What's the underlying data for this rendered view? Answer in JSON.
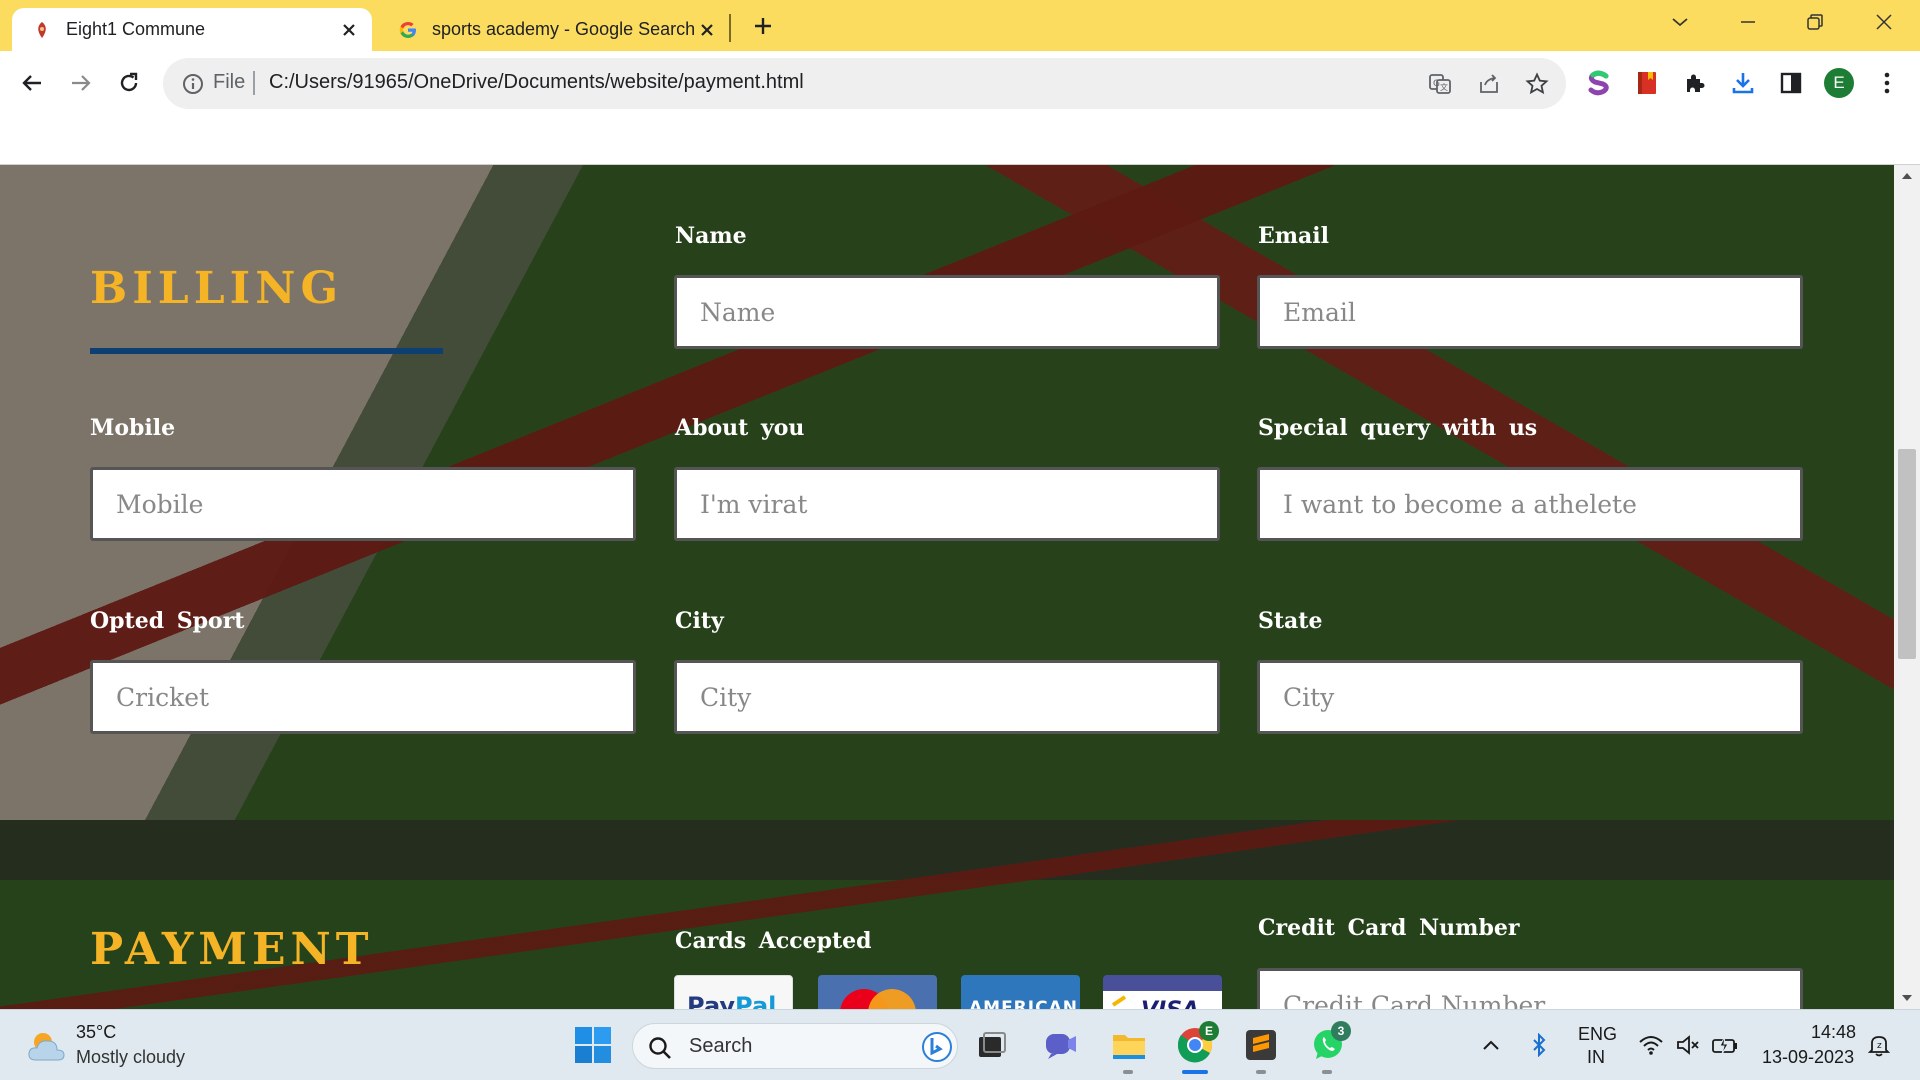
{
  "browser": {
    "tabs": [
      {
        "title": "Eight1 Commune",
        "active": true,
        "favicon": "app-favicon"
      },
      {
        "title": "sports academy - Google Search",
        "active": false,
        "favicon": "google-favicon"
      }
    ],
    "address": {
      "scheme_label": "File",
      "url": "C:/Users/91965/OneDrive/Documents/website/payment.html"
    },
    "profile_initial": "E"
  },
  "page": {
    "billing": {
      "title": "BILLING",
      "fields": [
        {
          "label": "Name",
          "placeholder": "Name"
        },
        {
          "label": "Email",
          "placeholder": "Email"
        },
        {
          "label": "Mobile",
          "placeholder": "Mobile"
        },
        {
          "label": "About  you",
          "placeholder": "I'm virat"
        },
        {
          "label": "Special  query  with  us",
          "placeholder": "I want to become a athelete"
        },
        {
          "label": "Opted  Sport",
          "placeholder": "Cricket"
        },
        {
          "label": "City",
          "placeholder": "City"
        },
        {
          "label": "State",
          "placeholder": "City"
        }
      ]
    },
    "payment": {
      "title": "PAYMENT",
      "cards_label": "Cards  Accepted",
      "card_number_label": "Credit  Card  Number",
      "card_number_placeholder": "Credit Card Number",
      "cards": [
        "PayPal",
        "Mastercard",
        "American Express",
        "Visa"
      ]
    }
  },
  "taskbar": {
    "weather": {
      "temp": "35°C",
      "desc": "Mostly cloudy"
    },
    "search_placeholder": "Search",
    "chrome_badge": "E",
    "whatsapp_badge": "3",
    "lang": {
      "line1": "ENG",
      "line2": "IN"
    },
    "clock": {
      "time": "14:48",
      "date": "13-09-2023"
    }
  },
  "colors": {
    "titlebar": "#fcdc5f",
    "accent_gold": "#f5b326",
    "underline_blue": "#0e3f73"
  }
}
